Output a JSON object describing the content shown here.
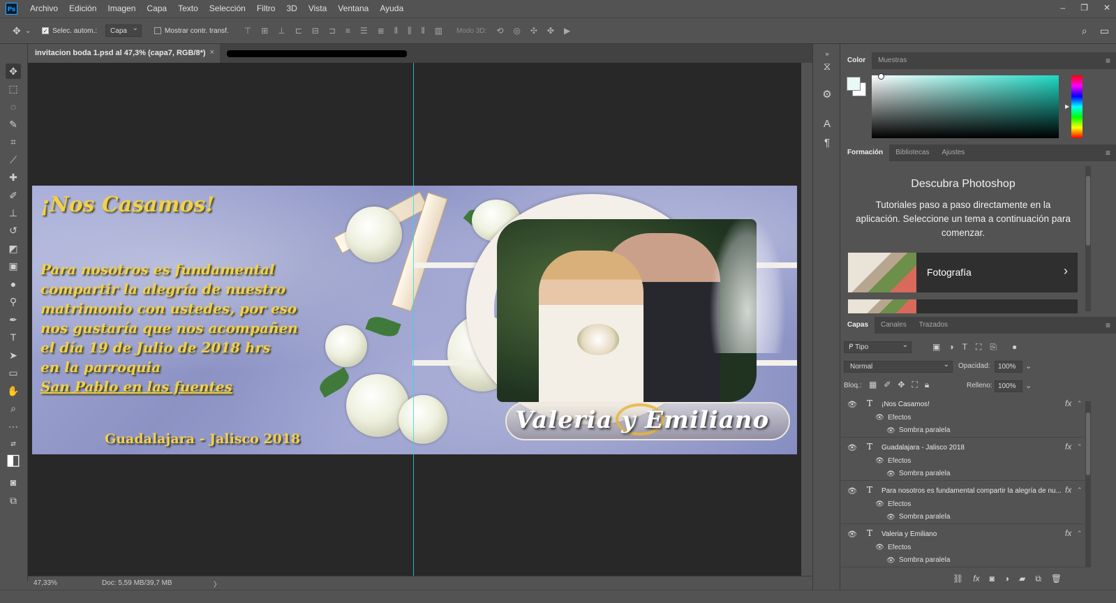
{
  "menu": [
    "Archivo",
    "Edición",
    "Imagen",
    "Capa",
    "Texto",
    "Selección",
    "Filtro",
    "3D",
    "Vista",
    "Ventana",
    "Ayuda"
  ],
  "app_logo": "Ps",
  "window_controls": [
    "‒",
    "❐",
    "✕"
  ],
  "options": {
    "auto_select_label": "Selec. autom.:",
    "auto_select_checked": true,
    "auto_select_target": "Capa",
    "show_transform_label": "Mostrar contr. transf.",
    "show_transform_checked": false,
    "mode_3d_label": "Modo 3D:"
  },
  "document": {
    "tab_title": "invitacion boda 1.psd al 47,3% (capa7, RGB/8*)",
    "tab_close": "×",
    "second_tab_redacted": true
  },
  "invitation": {
    "title": "¡Nos Casamos!",
    "body_lines": [
      "Para nosotros es fundamental",
      "compartir la alegría de nuestro",
      "matrimonio con ustedes, por eso",
      "nos gustaría que nos acompañen",
      "el día 19 de Julio de 2018 hrs",
      "en la parroquia"
    ],
    "body_last_line": "San Pablo en las fuentes",
    "city": "Guadalajara - Jalisco 2018",
    "names": "Valeria y Emiliano"
  },
  "status": {
    "zoom": "47,33%",
    "doc_size": "Doc: 5,59 MB/39,7 MB",
    "arrow": "〉"
  },
  "color_panel": {
    "tabs": [
      "Color",
      "Muestras"
    ],
    "active_tab": "Color",
    "foreground_color": "#eaf8f6",
    "background_color": "#ffffff"
  },
  "learn_panel": {
    "tabs": [
      "Formación",
      "Bibliotecas",
      "Ajustes"
    ],
    "active_tab": "Formación",
    "title": "Descubra Photoshop",
    "description": "Tutoriales paso a paso directamente en la aplicación. Seleccione un tema a continuación para comenzar.",
    "card_label": "Fotografía",
    "card_chevron": "›"
  },
  "layers_panel": {
    "tabs": [
      "Capas",
      "Canales",
      "Trazados"
    ],
    "active_tab": "Capas",
    "filter": "ᑭ Tipo",
    "blend_mode": "Normal",
    "opacity_label": "Opacidad:",
    "opacity": "100%",
    "lock_label": "Bloq.:",
    "fill_label": "Relleno:",
    "fill": "100%",
    "layers": [
      {
        "name": "¡Nos Casamos!",
        "effects_label": "Efectos",
        "effect": "Sombra paralela"
      },
      {
        "name": "Guadalajara - Jalisco 2018",
        "effects_label": "Efectos",
        "effect": "Sombra paralela"
      },
      {
        "name": "Para nosotros es fundamental compartir la alegría de nu...",
        "effects_label": "Efectos",
        "effect": "Sombra paralela"
      },
      {
        "name": "Valeria y Emiliano",
        "effects_label": "Efectos",
        "effect": "Sombra paralela"
      }
    ],
    "layer_type_glyph": "T",
    "fx_glyph": "fx"
  },
  "colors": {
    "ui_bg": "#535353",
    "ui_dark": "#424242",
    "canvas_bg": "#282828",
    "guide": "#2fd5e6",
    "invite_text": "#f2d04a"
  }
}
